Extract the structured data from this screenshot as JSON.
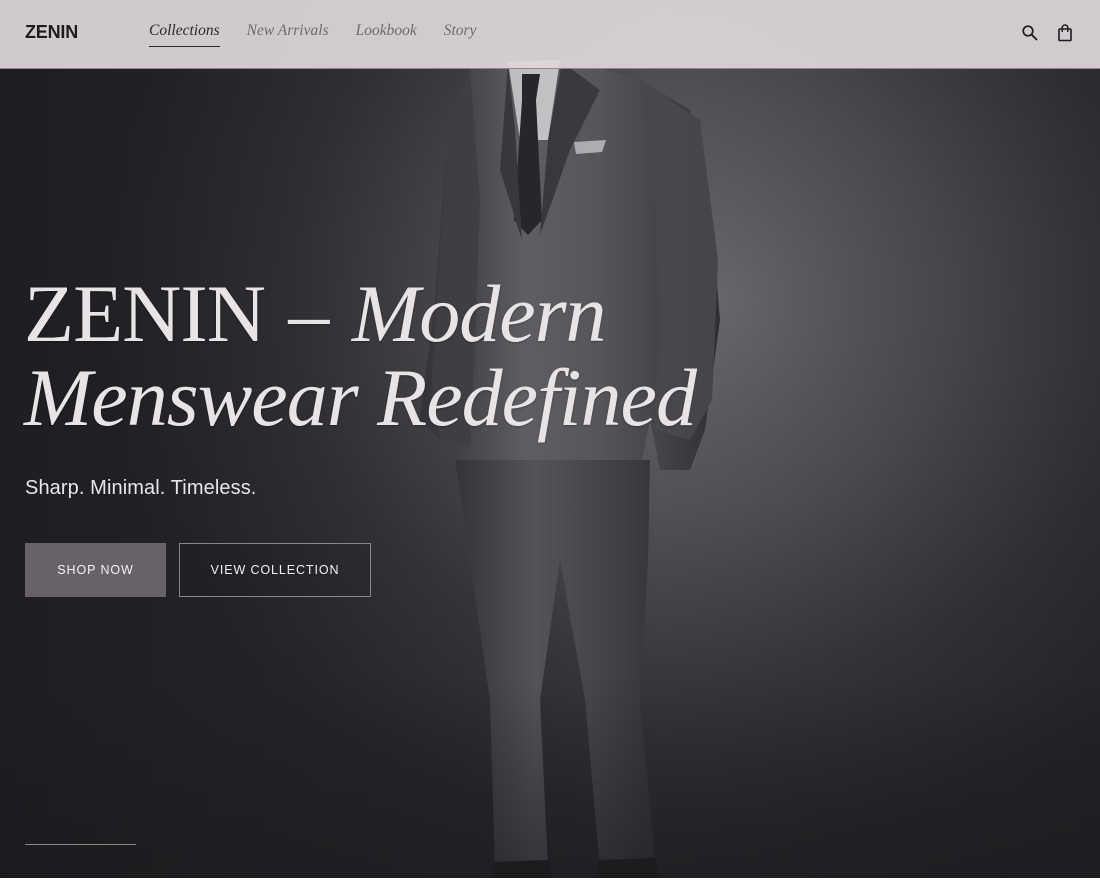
{
  "brand": {
    "logo": "ZENIN"
  },
  "nav": {
    "items": [
      {
        "label": "Collections",
        "active": true
      },
      {
        "label": "New Arrivals",
        "active": false
      },
      {
        "label": "Lookbook",
        "active": false
      },
      {
        "label": "Story",
        "active": false
      }
    ]
  },
  "header_icons": [
    "search-icon",
    "shopping-bag-icon"
  ],
  "hero": {
    "headline_brand": "ZENIN",
    "headline_dash": "–",
    "headline_line1_em": "Modern",
    "headline_line2": "Menswear Redefined",
    "tagline": "Sharp. Minimal. Timeless.",
    "primary_cta": "SHOP NOW",
    "secondary_cta": "VIEW COLLECTION"
  },
  "colors": {
    "header_bg": "#ded7db",
    "primary_button": "#67626a",
    "headline_text": "#e8e4e6"
  }
}
